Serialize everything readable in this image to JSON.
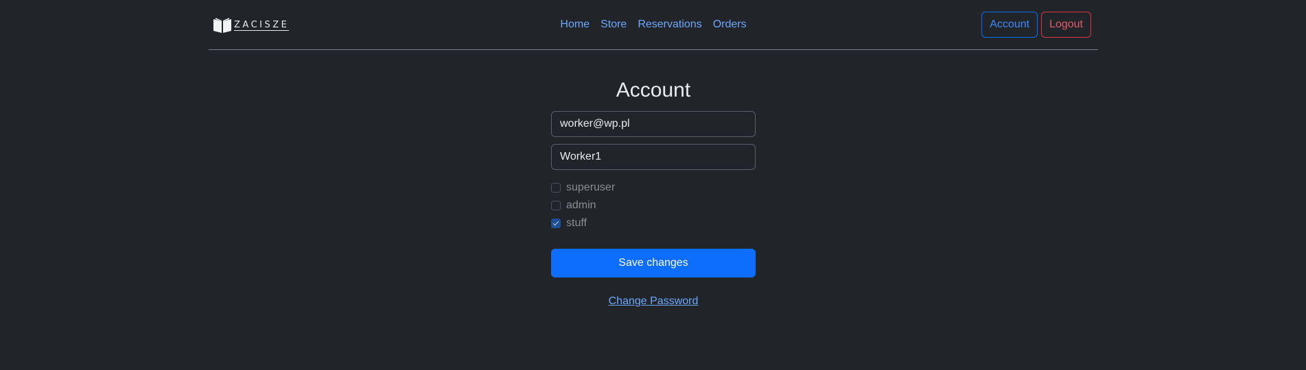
{
  "brand": {
    "name": "ZACISZE",
    "logo_icon": "open-book-icon"
  },
  "nav": {
    "items": [
      {
        "label": "Home"
      },
      {
        "label": "Store"
      },
      {
        "label": "Reservations"
      },
      {
        "label": "Orders"
      }
    ]
  },
  "auth": {
    "account_label": "Account",
    "logout_label": "Logout"
  },
  "colors": {
    "background": "#212529",
    "primary": "#0d6efd",
    "link": "#6ea8fe",
    "danger": "#dc3545"
  },
  "account_form": {
    "title": "Account",
    "email_value": "worker@wp.pl",
    "name_value": "Worker1",
    "checkboxes": [
      {
        "label": "superuser",
        "checked": false
      },
      {
        "label": "admin",
        "checked": false
      },
      {
        "label": "stuff",
        "checked": true
      }
    ],
    "save_label": "Save changes",
    "change_password_label": "Change Password"
  }
}
